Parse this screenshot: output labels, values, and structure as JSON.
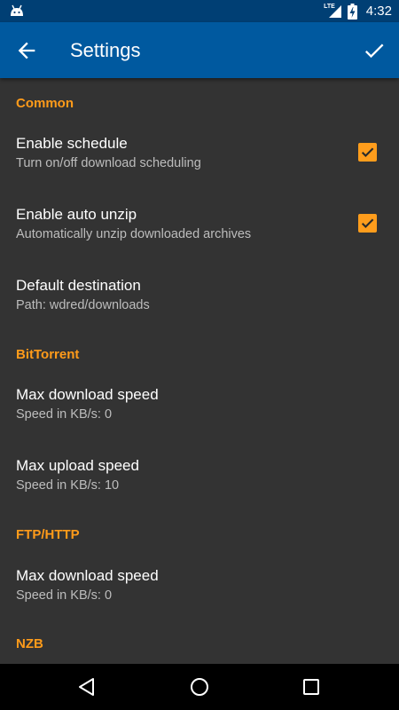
{
  "status": {
    "network": "LTE",
    "time": "4:32"
  },
  "app_bar": {
    "title": "Settings"
  },
  "sections": {
    "common": {
      "header": "Common"
    },
    "bittorrent": {
      "header": "BitTorrent"
    },
    "ftp_http": {
      "header": "FTP/HTTP"
    },
    "nzb": {
      "header": "NZB"
    }
  },
  "prefs": {
    "enable_schedule": {
      "title": "Enable schedule",
      "summary": "Turn on/off download scheduling",
      "checked": true
    },
    "enable_auto_unzip": {
      "title": "Enable auto unzip",
      "summary": "Automatically unzip downloaded archives",
      "checked": true
    },
    "default_destination": {
      "title": "Default destination",
      "summary": "Path: wdred/downloads"
    },
    "bt_max_download": {
      "title": "Max download speed",
      "summary": "Speed in KB/s: 0"
    },
    "bt_max_upload": {
      "title": "Max upload speed",
      "summary": "Speed in KB/s: 10"
    },
    "ftp_max_download": {
      "title": "Max download speed",
      "summary": "Speed in KB/s: 0"
    }
  },
  "colors": {
    "accent": "#ff9b1a",
    "app_bar": "#00599f",
    "status_bar": "#003f74",
    "background": "#333333"
  },
  "icons": [
    "android-icon",
    "signal-icon",
    "battery-charging-icon",
    "back-arrow-icon",
    "check-icon",
    "nav-back-icon",
    "nav-home-icon",
    "nav-recents-icon"
  ]
}
